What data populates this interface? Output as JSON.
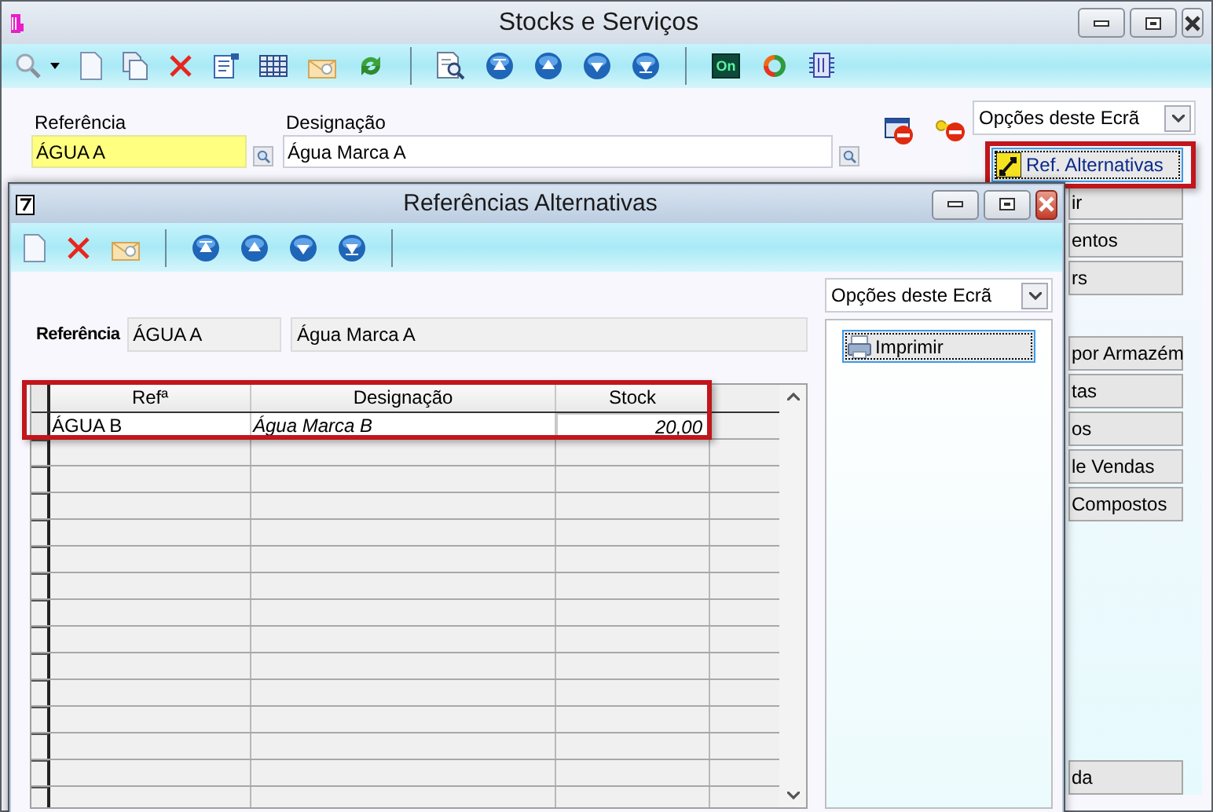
{
  "window": {
    "title": "Stocks e Serviços"
  },
  "toolbar": {
    "on_label": "On"
  },
  "fields": [
    {
      "label": "Referência",
      "value": "ÁGUA A",
      "kind": "key"
    },
    {
      "label": "Designação",
      "value": "Água Marca A",
      "kind": "text"
    }
  ],
  "options_dropdown": {
    "value": "Opções deste Ecrã"
  },
  "option_button": {
    "label": "Ref. Alternativas",
    "focused": true,
    "highlighted": true
  },
  "side_buttons": [
    [
      {
        "label": "ir"
      },
      {
        "label": "entos"
      },
      {
        "label": "rs"
      }
    ],
    [
      {
        "label": "por Armazém"
      },
      {
        "label": "tas"
      },
      {
        "label": "os"
      },
      {
        "label": "le Vendas"
      },
      {
        "label": "Compostos"
      }
    ],
    [
      {
        "label": "da"
      }
    ]
  ],
  "dialog": {
    "title": "Referências Alternativas",
    "reference": {
      "label": "Referência",
      "code": "ÁGUA A",
      "description": "Água Marca A"
    },
    "table": {
      "highlighted": true,
      "columns": [
        "Refª",
        "Designação",
        "Stock"
      ],
      "rows": [
        {
          "cells": [
            "ÁGUA B",
            "Água Marca B",
            "20,00"
          ]
        }
      ]
    },
    "options_dropdown": {
      "value": "Opções deste Ecrã"
    },
    "options": [
      {
        "label": "Imprimir",
        "focused": true
      }
    ]
  }
}
